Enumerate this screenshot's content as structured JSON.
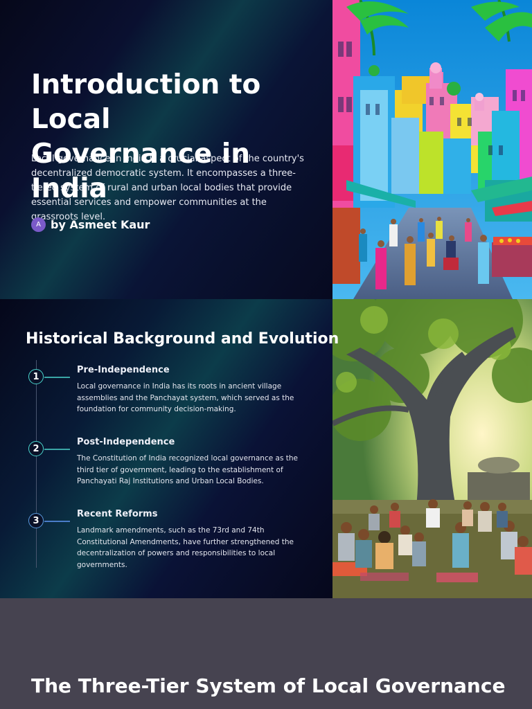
{
  "slide1": {
    "title": "Introduction to Local Governance in India",
    "description": "Local governance in India is a crucial aspect of the country's decentralized democratic system. It encompasses a three-tiered system of rural and urban local bodies that provide essential services and empower communities at the grassroots level.",
    "author_initial": "A",
    "author": "by Asmeet Kaur"
  },
  "slide2": {
    "title": "Historical Background and Evolution",
    "timeline": [
      {
        "number": "1",
        "heading": "Pre-Independence",
        "body": "Local governance in India has its roots in ancient village assemblies and the Panchayat system, which served as the foundation for community decision-making."
      },
      {
        "number": "2",
        "heading": "Post-Independence",
        "body": "The Constitution of India recognized local governance as the third tier of government, leading to the establishment of Panchayati Raj Institutions and Urban Local Bodies."
      },
      {
        "number": "3",
        "heading": "Recent Reforms",
        "body": "Landmark amendments, such as the 73rd and 74th Constitutional Amendments, have further strengthened the decentralization of powers and responsibilities to local governments."
      }
    ]
  },
  "slide3": {
    "title": "The Three-Tier System of Local Governance"
  },
  "colors": {
    "dark_bg": "#070a20",
    "accent_teal": "#4ad8d0",
    "accent_blue": "#5a9be0",
    "avatar": "#7a5ac8",
    "footer_bg": "#464350"
  }
}
